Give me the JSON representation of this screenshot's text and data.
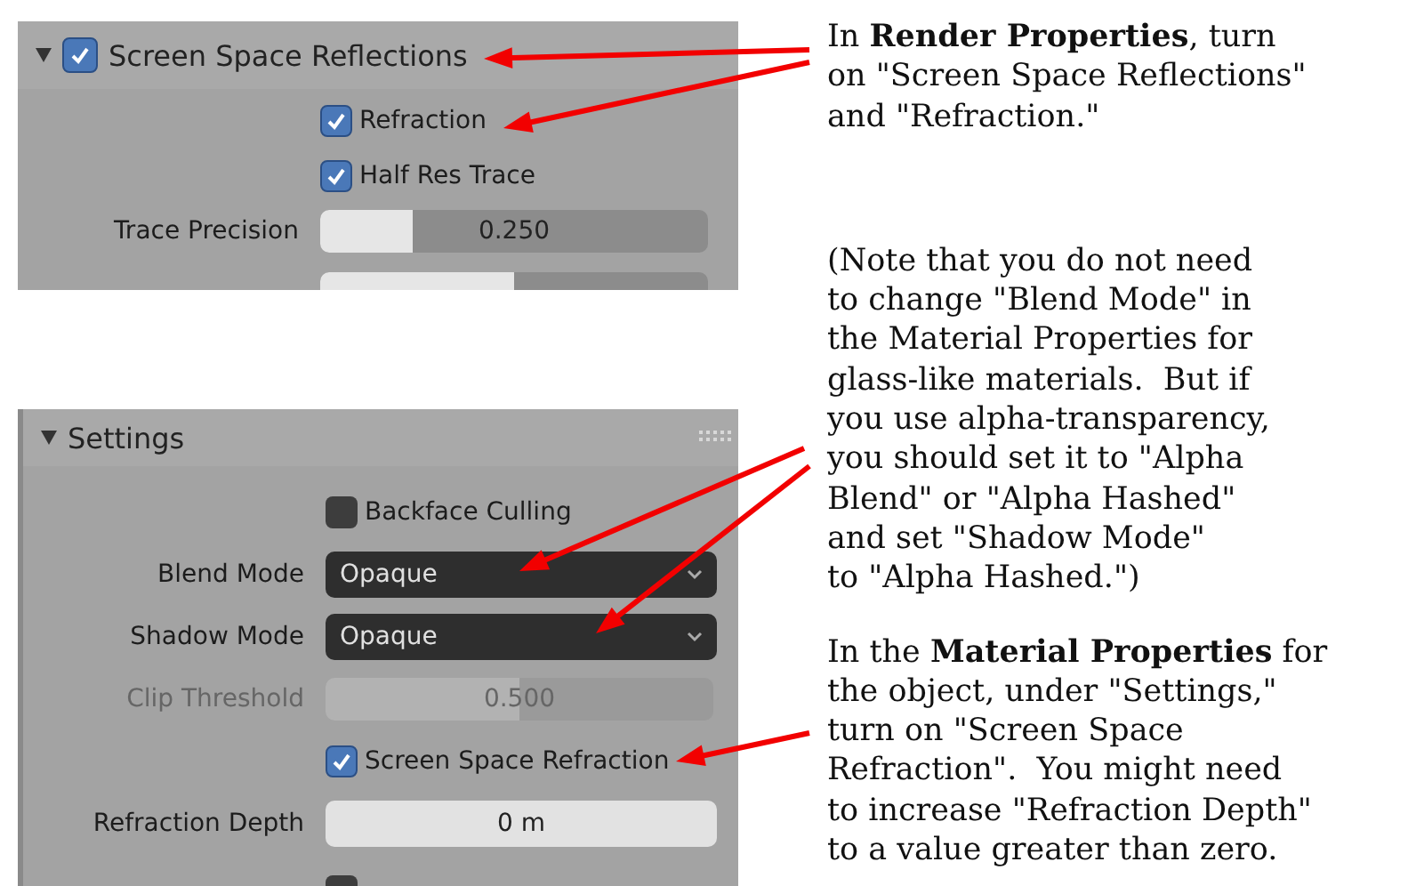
{
  "panels": [
    {
      "header": {
        "label": "Screen Space Reflections",
        "checked": true,
        "expanded": true
      },
      "rows": [
        {
          "kind": "checkbox",
          "label": "Refraction",
          "checked": true
        },
        {
          "kind": "checkbox",
          "label": "Half Res Trace",
          "checked": true
        },
        {
          "kind": "slider",
          "label": "Trace Precision",
          "value": "0.250",
          "level": 0.24,
          "disabled": false
        },
        {
          "kind": "cut-slider",
          "level": 0.5
        }
      ]
    },
    {
      "header": {
        "label": "Settings",
        "expanded": true
      },
      "rows": [
        {
          "kind": "checkbox",
          "label": "Backface Culling",
          "checked": false
        },
        {
          "kind": "dropdown",
          "label": "Blend Mode",
          "value": "Opaque"
        },
        {
          "kind": "dropdown",
          "label": "Shadow Mode",
          "value": "Opaque"
        },
        {
          "kind": "slider",
          "label": "Clip Threshold",
          "value": "0.500",
          "level": 0.5,
          "disabled": true
        },
        {
          "kind": "checkbox",
          "label": "Screen Space Refraction",
          "checked": true
        },
        {
          "kind": "field",
          "label": "Refraction Depth",
          "value": "0 m"
        },
        {
          "kind": "cut-checkbox",
          "checked": false
        }
      ]
    }
  ],
  "notes": [
    "In **Render Properties**, turn\non \"Screen Space Reflections\"\nand \"Refraction.\"",
    "(Note that you do not need\nto change \"Blend Mode\" in\nthe Material Properties for\nglass-like materials.  But if\nyou use alpha-transparency,\nyou should set it to \"Alpha\nBlend\" or \"Alpha Hashed\"\nand set \"Shadow Mode\"\nto \"Alpha Hashed.\")",
    "In the **Material Properties** for\nthe object, under \"Settings,\"\nturn on \"Screen Space\nRefraction\".  You might need\nto increase \"Refraction Depth\"\nto a value greater than zero."
  ]
}
